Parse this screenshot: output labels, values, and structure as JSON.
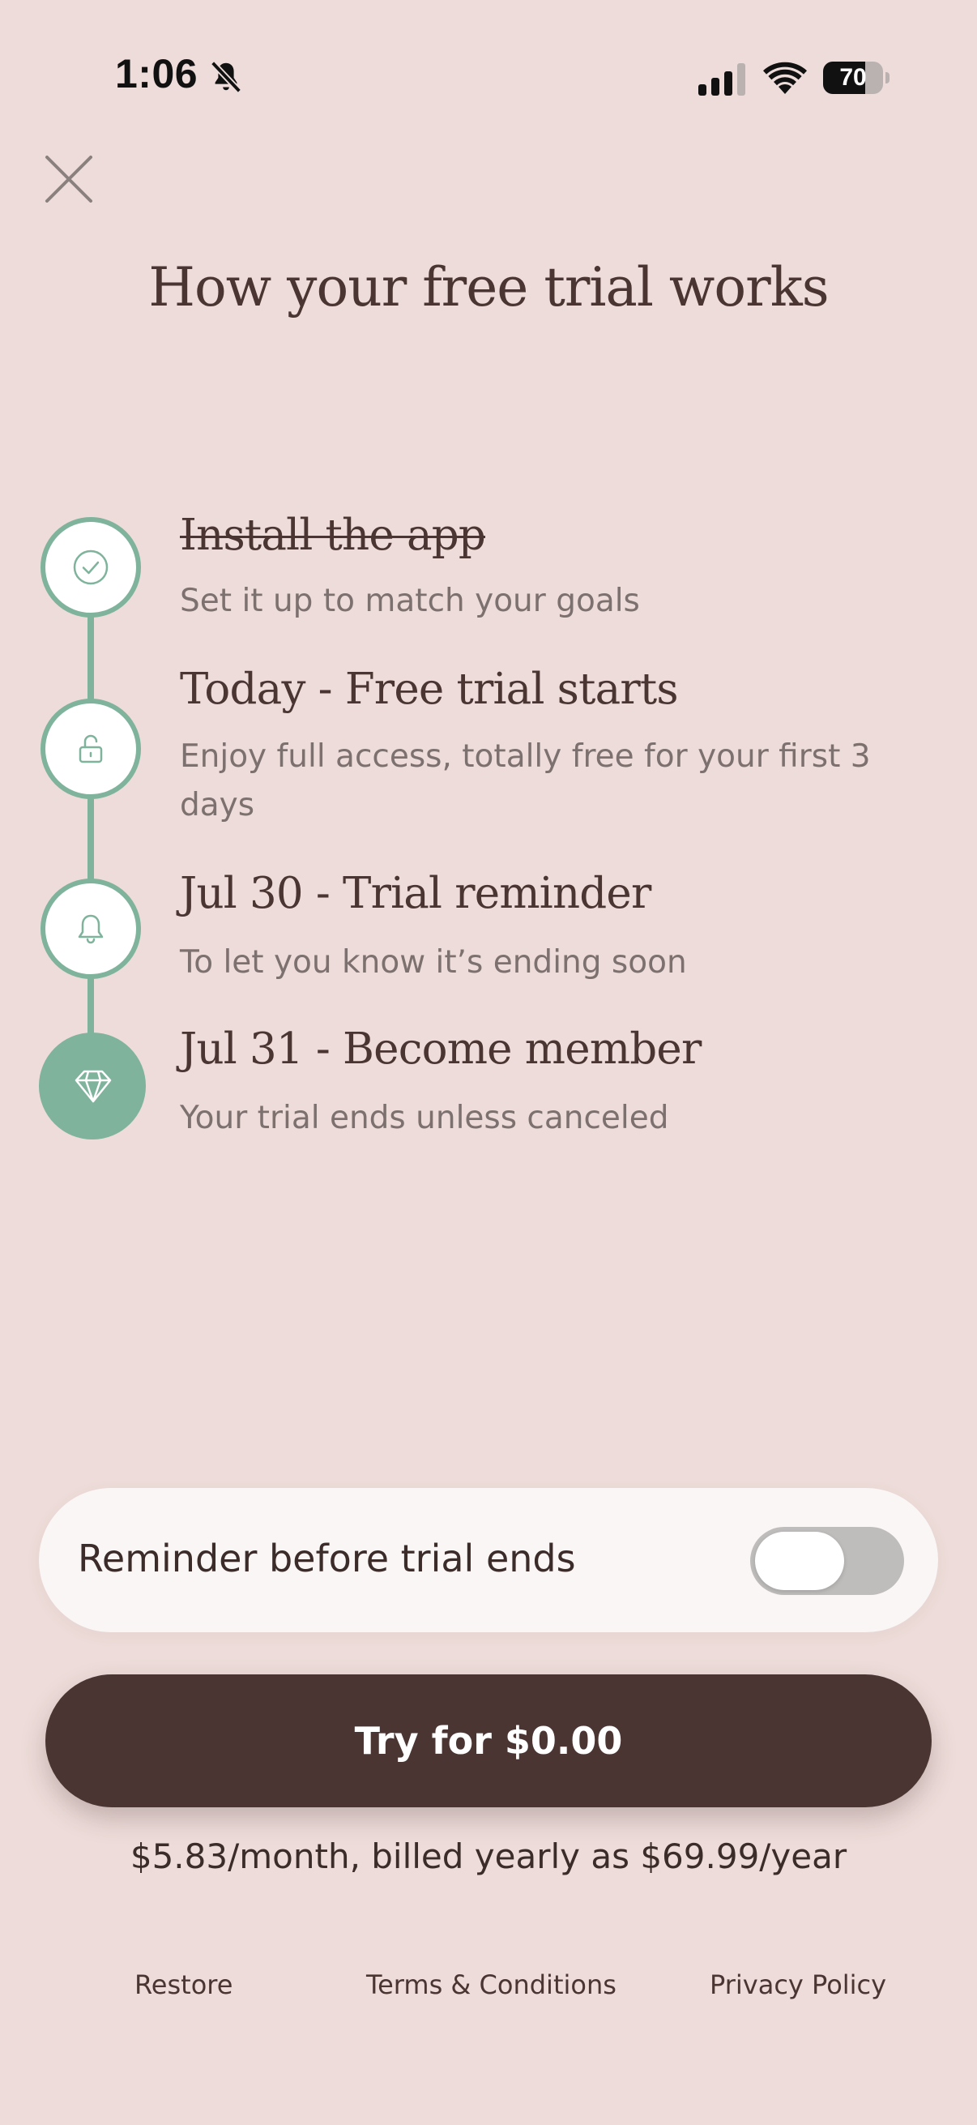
{
  "status_bar": {
    "time": "1:06",
    "battery_level": "70",
    "battery_fraction": 0.7
  },
  "header": {
    "title": "How your free trial works"
  },
  "timeline": [
    {
      "title": "Install the app",
      "description": "Set it up to match your goals",
      "completed": true,
      "icon": "check-icon"
    },
    {
      "title": "Today - Free trial starts",
      "description": "Enjoy full access, totally free for your first 3 days",
      "completed": false,
      "icon": "unlock-icon"
    },
    {
      "title": "Jul 30 - Trial reminder",
      "description": "To let you know it’s ending soon",
      "completed": false,
      "icon": "bell-icon"
    },
    {
      "title": "Jul 31 - Become member",
      "description": "Your trial ends unless canceled",
      "completed": false,
      "icon": "diamond-icon"
    }
  ],
  "reminder": {
    "label": "Reminder before trial ends",
    "enabled": false
  },
  "cta": {
    "label": "Try for $0.00"
  },
  "pricing": {
    "note": "$5.83/month, billed yearly as $69.99/year"
  },
  "footer": {
    "restore": "Restore",
    "terms": "Terms & Conditions",
    "privacy": "Privacy Policy"
  },
  "colors": {
    "background": "#eddcd9",
    "primary": "#4a3533",
    "accent": "#7fb39c",
    "muted_text": "#7d716f",
    "toggle_off": "#bfbdbc"
  }
}
